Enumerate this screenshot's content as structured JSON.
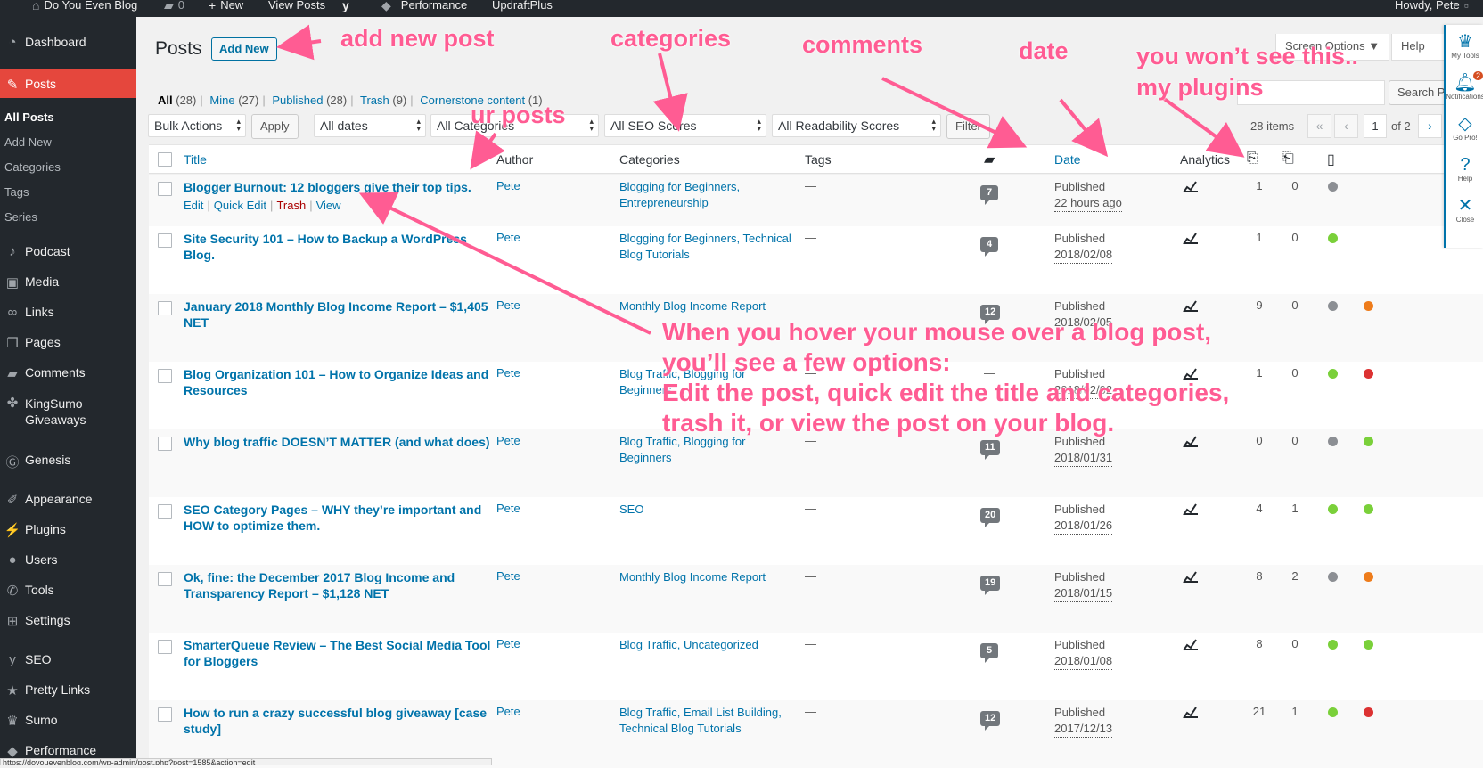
{
  "adminbar": {
    "site_name": "Do You Even Blog",
    "comments_count": "0",
    "new_label": "New",
    "view_posts": "View Posts",
    "performance": "Performance",
    "updraft": "UpdraftPlus",
    "howdy": "Howdy, Pete"
  },
  "sidebar": {
    "dashboard": "Dashboard",
    "posts": "Posts",
    "sub": [
      "All Posts",
      "Add New",
      "Categories",
      "Tags",
      "Series"
    ],
    "podcast": "Podcast",
    "media": "Media",
    "links": "Links",
    "pages": "Pages",
    "comments": "Comments",
    "kingsumo": "KingSumo Giveaways",
    "genesis": "Genesis",
    "appearance": "Appearance",
    "plugins": "Plugins",
    "users": "Users",
    "tools": "Tools",
    "settings": "Settings",
    "seo": "SEO",
    "pretty_links": "Pretty Links",
    "sumo": "Sumo",
    "performance": "Performance"
  },
  "page": {
    "title": "Posts",
    "add_new": "Add New",
    "screen_options": "Screen Options ▼",
    "help": "Help",
    "search_button": "Search Po"
  },
  "views": [
    {
      "label": "All",
      "count": "(28)"
    },
    {
      "label": "Mine",
      "count": "(27)"
    },
    {
      "label": "Published",
      "count": "(28)"
    },
    {
      "label": "Trash",
      "count": "(9)"
    },
    {
      "label": "Cornerstone content",
      "count": "(1)"
    }
  ],
  "filters": {
    "bulk_actions": "Bulk Actions",
    "apply": "Apply",
    "all_dates": "All dates",
    "all_categories": "All Categories",
    "all_seo": "All SEO Scores",
    "all_readability": "All Readability Scores",
    "filter": "Filter",
    "items": "28 items",
    "first": "«",
    "prev": "‹",
    "current_page": "1",
    "of_pages": "of 2",
    "next": "›"
  },
  "columns": {
    "title": "Title",
    "author": "Author",
    "categories": "Categories",
    "tags": "Tags",
    "date": "Date",
    "analytics": "Analytics"
  },
  "row_actions": {
    "edit": "Edit",
    "quick_edit": "Quick Edit",
    "trash": "Trash",
    "view": "View"
  },
  "posts": [
    {
      "title": "Blogger Burnout: 12 bloggers give their top tips.",
      "author": "Pete",
      "categories": "Blogging for Beginners, Entrepreneurship",
      "tags": "—",
      "comments": "7",
      "status": "Published",
      "date": "22 hours ago",
      "c1": "1",
      "c2": "0",
      "seo": "#8c8f94",
      "read": ""
    },
    {
      "title": "Site Security 101 – How to Backup a WordPress Blog.",
      "author": "Pete",
      "categories": "Blogging for Beginners, Technical Blog Tutorials",
      "tags": "—",
      "comments": "4",
      "status": "Published",
      "date": "2018/02/08",
      "c1": "1",
      "c2": "0",
      "seo": "#7ad03a",
      "read": ""
    },
    {
      "title": "January 2018 Monthly Blog Income Report – $1,405 NET",
      "author": "Pete",
      "categories": "Monthly Blog Income Report",
      "tags": "—",
      "comments": "12",
      "status": "Published",
      "date": "2018/02/05",
      "c1": "9",
      "c2": "0",
      "seo": "#8c8f94",
      "read": "#ee7c1b"
    },
    {
      "title": "Blog Organization 101 – How to Organize Ideas and Resources",
      "author": "Pete",
      "categories": "Blog Traffic, Blogging for Beginners",
      "tags": "—",
      "comments": "",
      "status": "Published",
      "date": "2018/02/02",
      "c1": "1",
      "c2": "0",
      "seo": "#7ad03a",
      "read": "#dc3232"
    },
    {
      "title": "Why blog traffic DOESN’T MATTER (and what does)",
      "author": "Pete",
      "categories": "Blog Traffic, Blogging for Beginners",
      "tags": "—",
      "comments": "11",
      "status": "Published",
      "date": "2018/01/31",
      "c1": "0",
      "c2": "0",
      "seo": "#8c8f94",
      "read": "#7ad03a"
    },
    {
      "title": "SEO Category Pages – WHY they’re important and HOW to optimize them.",
      "author": "Pete",
      "categories": "SEO",
      "tags": "—",
      "comments": "20",
      "status": "Published",
      "date": "2018/01/26",
      "c1": "4",
      "c2": "1",
      "seo": "#7ad03a",
      "read": "#7ad03a"
    },
    {
      "title": "Ok, fine: the December 2017 Blog Income and Transparency Report – $1,128 NET",
      "author": "Pete",
      "categories": "Monthly Blog Income Report",
      "tags": "—",
      "comments": "19",
      "status": "Published",
      "date": "2018/01/15",
      "c1": "8",
      "c2": "2",
      "seo": "#8c8f94",
      "read": "#ee7c1b"
    },
    {
      "title": "SmarterQueue Review – The Best Social Media Tool for Bloggers",
      "author": "Pete",
      "categories": "Blog Traffic, Uncategorized",
      "tags": "—",
      "comments": "5",
      "status": "Published",
      "date": "2018/01/08",
      "c1": "8",
      "c2": "0",
      "seo": "#7ad03a",
      "read": "#7ad03a"
    },
    {
      "title": "How to run a crazy successful blog giveaway [case study]",
      "author": "Pete",
      "categories": "Blog Traffic, Email List Building, Technical Blog Tutorials",
      "tags": "—",
      "comments": "12",
      "status": "Published",
      "date": "2017/12/13",
      "c1": "21",
      "c2": "1",
      "seo": "#7ad03a",
      "read": "#dc3232"
    }
  ],
  "plugin_panel": {
    "my_tools": "My Tools",
    "notifications": "Notifications",
    "notif_count": "2",
    "go_pro": "Go Pro!",
    "help": "Help",
    "close": "Close"
  },
  "annotations": {
    "add_new_post": "add new post",
    "categories": "categories",
    "comments": "comments",
    "date": "date",
    "plugins_line1": "you won’t see this..",
    "plugins_line2": "my plugins",
    "ur_posts": "ur posts",
    "hover_line1": "When you hover your mouse over a blog post,",
    "hover_line2": "you’ll see a few options:",
    "hover_line3": "Edit the post, quick edit the title and categories,",
    "hover_line4": "trash it, or view the post on your blog."
  },
  "status_url": "https://doyouevenblog.com/wp-admin/post.php?post=1585&action=edit",
  "colors": {
    "accent": "#0073aa",
    "active_menu": "#e5473d",
    "annotation": "#ff5c93"
  }
}
